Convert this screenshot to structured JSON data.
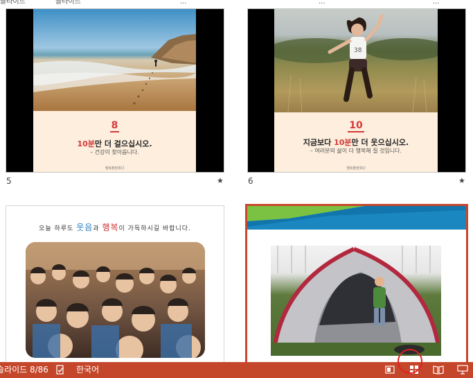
{
  "top_strip": {
    "labels": [
      "슬라이드",
      "슬라이드",
      "슬라이드",
      "...",
      "...",
      "..."
    ]
  },
  "slides": [
    {
      "number": "5",
      "star": "★",
      "big_number": "8",
      "line_pre": "",
      "line_highlight": "10분",
      "line_post": "만 더 걸으십시오.",
      "sub": "– 건강이 찾아옵니다.",
      "credit": "행복출판회다"
    },
    {
      "number": "6",
      "star": "★",
      "big_number": "10",
      "line_pre": "지금보다 ",
      "line_highlight": "10분",
      "line_post": "만 더 웃으십시오.",
      "sub": "– 여러분의 삶이 더 행복해 질 것입니다.",
      "credit": "행복출판회다"
    },
    {
      "caption_pre": "오늘 하루도 ",
      "caption_blue": "웃음",
      "caption_mid": "과 ",
      "caption_red": "행복",
      "caption_post": "이 가득하시길 바랍니다."
    },
    {
      "selected": true
    }
  ],
  "statusbar": {
    "slide_info": "슬라이드 8/86",
    "language": "한국어",
    "icons": [
      "spell-check-icon",
      "normal-view-icon",
      "slide-sorter-icon",
      "reading-view-icon",
      "slideshow-icon"
    ],
    "bg_color": "#c5472b"
  }
}
